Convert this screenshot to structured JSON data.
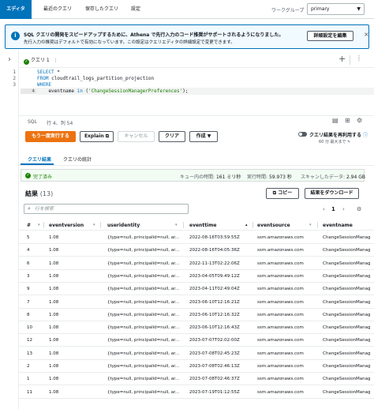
{
  "nav": {
    "tabs": [
      "エディタ",
      "最近のクエリ",
      "保存したクエリ",
      "設定"
    ],
    "workgroup_label": "ワークグループ",
    "workgroup_value": "primary"
  },
  "banner": {
    "title": "SQL クエリの開発をスピードアップするために、Athena で先行入力のコード推奨がサポートされるようになりました。",
    "body": "先行入力の推奨はデフォルトで有効になっています。この設定はクエリエディタの詳細設定で変更できます。",
    "button": "詳細設定を編集",
    "close": "×"
  },
  "query_tab": {
    "label": "クエリ 1",
    "more": "⋮"
  },
  "editor": {
    "line_numbers": [
      "1",
      "2",
      "3",
      "4"
    ],
    "lines": [
      {
        "kw": "SELECT",
        "rest": " *"
      },
      {
        "kw": "FROM",
        "rest": " cloudtrail_logs_partition_projection"
      },
      {
        "kw": "WHERE",
        "rest": ""
      },
      {
        "pre": "    eventname ",
        "kw": "in",
        "mid": " (",
        "str": "'ChangeSessionManagerPreferences'",
        "post": ");"
      }
    ]
  },
  "status": {
    "language": "SQL",
    "position": "行 4、列 54"
  },
  "actions": {
    "run_again": "もう一度実行する",
    "explain": "Explain",
    "cancel": "キャンセル",
    "clear": "クリア",
    "create": "作成",
    "reuse_label": "クエリ結果を再利用する",
    "reuse_sub": "60 分 最大まで"
  },
  "result_tabs": [
    "クエリ結果",
    "クエリの統計"
  ],
  "summary": {
    "completed": "完了済み",
    "queue_label": "キュー内の時間:",
    "queue_value": "161 ミリ秒",
    "run_label": "実行時間:",
    "run_value": "59.973 秒",
    "scan_label": "スキャンしたデータ:",
    "scan_value": "2.94 GB"
  },
  "results": {
    "title": "結果",
    "count": "(13)",
    "copy": "コピー",
    "download": "結果をダウンロード",
    "filter_placeholder": "行を検索",
    "page": "1"
  },
  "table": {
    "columns": [
      "#",
      "eventversion",
      "useridentity",
      "eventtime",
      "eventsource",
      "eventname"
    ],
    "rows": [
      [
        "5",
        "1.08",
        "{type=null, principalid=null, ar...",
        "2022-08-16T03:59:55Z",
        "ssm.amazonaws.com",
        "ChangeSessionManag"
      ],
      [
        "4",
        "1.08",
        "{type=null, principalid=null, ar...",
        "2022-08-16T04:05:36Z",
        "ssm.amazonaws.com",
        "ChangeSessionManag"
      ],
      [
        "6",
        "1.08",
        "{type=null, principalid=null, ar...",
        "2022-11-13T02:22:06Z",
        "ssm.amazonaws.com",
        "ChangeSessionManag"
      ],
      [
        "3",
        "1.08",
        "{type=null, principalid=null, ar...",
        "2023-04-05T09:49:12Z",
        "ssm.amazonaws.com",
        "ChangeSessionManag"
      ],
      [
        "9",
        "1.08",
        "{type=null, principalid=null, ar...",
        "2023-04-11T02:49:04Z",
        "ssm.amazonaws.com",
        "ChangeSessionManag"
      ],
      [
        "7",
        "1.08",
        "{type=null, principalid=null, ar...",
        "2023-06-10T12:16:21Z",
        "ssm.amazonaws.com",
        "ChangeSessionManag"
      ],
      [
        "8",
        "1.08",
        "{type=null, principalid=null, ar...",
        "2023-06-10T12:16:32Z",
        "ssm.amazonaws.com",
        "ChangeSessionManag"
      ],
      [
        "10",
        "1.08",
        "{type=null, principalid=null, ar...",
        "2023-06-10T12:16:43Z",
        "ssm.amazonaws.com",
        "ChangeSessionManag"
      ],
      [
        "12",
        "1.08",
        "{type=null, principalid=null, ar...",
        "2023-07-07T02:02:00Z",
        "ssm.amazonaws.com",
        "ChangeSessionManag"
      ],
      [
        "13",
        "1.08",
        "{type=null, principalid=null, ar...",
        "2023-07-08T02:45:23Z",
        "ssm.amazonaws.com",
        "ChangeSessionManag"
      ],
      [
        "2",
        "1.08",
        "{type=null, principalid=null, ar...",
        "2023-07-08T02:46:13Z",
        "ssm.amazonaws.com",
        "ChangeSessionManag"
      ],
      [
        "1",
        "1.08",
        "{type=null, principalid=null, ar...",
        "2023-07-08T02:46:37Z",
        "ssm.amazonaws.com",
        "ChangeSessionManag"
      ],
      [
        "11",
        "1.08",
        "{type=null, principalid=null, ar...",
        "2023-07-19T01:12:55Z",
        "ssm.amazonaws.com",
        "ChangeSessionManag"
      ]
    ]
  },
  "colors": {
    "accent": "#0073bb",
    "run_button": "#ec7211",
    "success": "#1d8102"
  }
}
